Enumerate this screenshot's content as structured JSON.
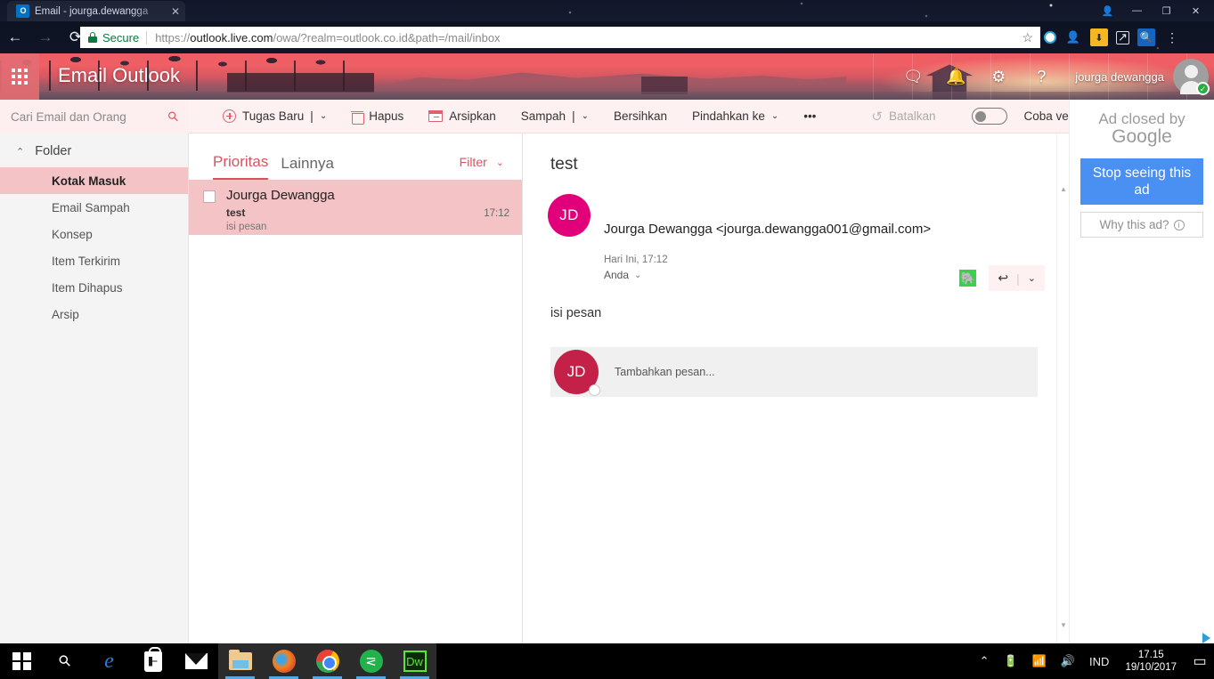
{
  "browser": {
    "tab_title": "Email - jourga.dewangga",
    "tab_close": "✕",
    "favicon_label": "O",
    "back_icon": "←",
    "forward_icon": "→",
    "reload_icon": "⟳",
    "security_label": "Secure",
    "url_scheme": "https://",
    "url_host": "outlook.live.com",
    "url_path": "/owa/?realm=outlook.co.id&path=/mail/inbox",
    "bookmark_icon": "☆",
    "menu_icon": "⋮",
    "window_minimize": "—",
    "window_maximize": "❐",
    "window_close": "✕",
    "window_user": "👤"
  },
  "owa_header": {
    "waffle_label": "app-launcher",
    "brand": "Email Outlook",
    "icons": [
      "skype-icon",
      "bell-icon",
      "gear-icon",
      "help-icon"
    ],
    "skype_glyph": "🗨",
    "bell_glyph": "🔔",
    "gear_glyph": "⚙",
    "help_glyph": "?",
    "user_name": "jourga dewangga",
    "status_glyph": "✓"
  },
  "search": {
    "placeholder": "Cari Email dan Orang",
    "value": "",
    "icon": "search-icon"
  },
  "commandbar": {
    "new_task": "Tugas Baru",
    "new_task_sep": "|",
    "delete": "Hapus",
    "archive": "Arsipkan",
    "junk": "Sampah",
    "junk_sep": "|",
    "sweep": "Bersihkan",
    "move_to": "Pindahkan ke",
    "more": "•••",
    "undo": "Batalkan",
    "undo_glyph": "↺",
    "beta_label": "Coba versi beta",
    "chevron": "⌄"
  },
  "leftnav": {
    "section_title": "Folder",
    "collapse_icon": "⌃",
    "items": [
      {
        "label": "Kotak Masuk",
        "active": true
      },
      {
        "label": "Email Sampah",
        "active": false
      },
      {
        "label": "Konsep",
        "active": false
      },
      {
        "label": "Item Terkirim",
        "active": false
      },
      {
        "label": "Item Dihapus",
        "active": false
      },
      {
        "label": "Arsip",
        "active": false
      }
    ],
    "footer_icons": [
      "mail-icon",
      "calendar-icon",
      "people-icon",
      "tasks-icon"
    ]
  },
  "msglist": {
    "tabs": [
      {
        "label": "Prioritas",
        "active": true
      },
      {
        "label": "Lainnya",
        "active": false
      }
    ],
    "filter_label": "Filter",
    "filter_chevron": "⌄",
    "messages": [
      {
        "from": "Jourga Dewangga",
        "subject": "test",
        "preview": "isi pesan",
        "time": "17:12",
        "selected": true
      }
    ]
  },
  "reading": {
    "subject": "test",
    "sender_avatar": "JD",
    "sender_line": "Jourga Dewangga <jourga.dewangga001@gmail.com>",
    "date": "Hari Ini, 17:12",
    "to_label": "Anda",
    "to_chevron": "⌄",
    "body": "isi pesan",
    "evernote_glyph": "🐘",
    "reply_glyph": "↩",
    "reply_sep": "|",
    "reply_chevron": "⌄",
    "reply_avatar": "JD",
    "reply_placeholder": "Tambahkan pesan...",
    "scroll_up": "▲",
    "scroll_down": "▼"
  },
  "ad": {
    "line1": "Ad closed by",
    "line2": "Google",
    "stop_button": "Stop seeing this ad",
    "why_button": "Why this ad?",
    "info_glyph": "i"
  },
  "taskbar": {
    "items": [
      {
        "name": "start-button",
        "active": false
      },
      {
        "name": "search-taskbar",
        "active": false
      },
      {
        "name": "edge-icon",
        "active": false
      },
      {
        "name": "store-icon",
        "active": false
      },
      {
        "name": "mail-app-icon",
        "active": false
      },
      {
        "name": "file-explorer-icon",
        "active": true
      },
      {
        "name": "firefox-icon",
        "active": true
      },
      {
        "name": "chrome-icon",
        "active": true
      },
      {
        "name": "smadav-icon",
        "active": true
      },
      {
        "name": "dreamweaver-icon",
        "active": true
      }
    ],
    "edge_glyph": "e",
    "dw_glyph": "Dw",
    "smadav_glyph": "⋜",
    "tray": {
      "chevron": "⌃",
      "battery": "🔋",
      "wifi": "📶",
      "volume": "🔊",
      "language": "IND",
      "time": "17.15",
      "date": "19/10/2017",
      "action_center": "▭"
    }
  }
}
